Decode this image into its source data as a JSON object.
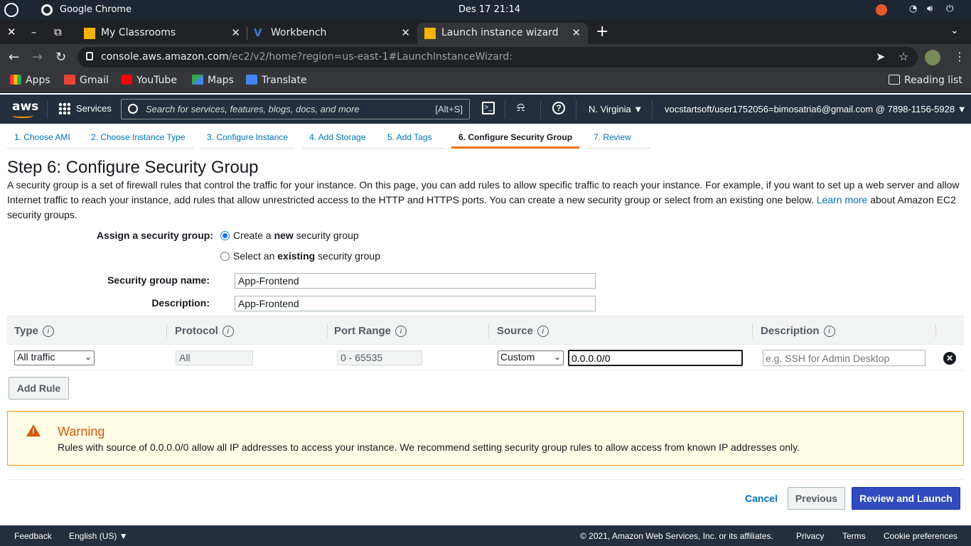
{
  "os": {
    "app_name": "Google Chrome",
    "clock": "Des 17  21:14",
    "tray": [
      "wifi-icon",
      "volume-icon",
      "power-icon"
    ]
  },
  "browser": {
    "tabs": [
      {
        "label": "My Classrooms",
        "icon": "classroom-icon",
        "color": "#f4b400"
      },
      {
        "label": "Workbench",
        "icon": "vocareum-icon",
        "color": "#3a7bd5"
      },
      {
        "label": "Launch instance wizard | E",
        "icon": "aws-cube-icon",
        "color": "#f4b400"
      }
    ],
    "url_host": "console.aws.amazon.com",
    "url_path": "/ec2/v2/home?region=us-east-1#LaunchInstanceWizard:",
    "bookmarks": [
      {
        "label": "Apps",
        "icon": "apps-grid-icon",
        "color": "#ea4335"
      },
      {
        "label": "Gmail",
        "icon": "gmail-icon",
        "color": "#ea4335"
      },
      {
        "label": "YouTube",
        "icon": "youtube-icon",
        "color": "#ff0000"
      },
      {
        "label": "Maps",
        "icon": "maps-icon",
        "color": "#34a853"
      },
      {
        "label": "Translate",
        "icon": "translate-icon",
        "color": "#4285f4"
      }
    ],
    "reading_list": "Reading list"
  },
  "aws": {
    "logo": "aws",
    "services": "Services",
    "search_placeholder": "Search for services, features, blogs, docs, and more",
    "search_shortcut": "[Alt+S]",
    "region": "N. Virginia",
    "account": "vocstartsoft/user1752056=bimosatria6@gmail.com @ 7898-1156-5928"
  },
  "wizard": {
    "steps": [
      "1. Choose AMI",
      "2. Choose Instance Type",
      "3. Configure Instance",
      "4. Add Storage",
      "5. Add Tags",
      "6. Configure Security Group",
      "7. Review"
    ],
    "active_step": 5,
    "title": "Step 6: Configure Security Group",
    "intro_text": "A security group is a set of firewall rules that control the traffic for your instance. On this page, you can add rules to allow specific traffic to reach your instance. For example, if you want to set up a web server and allow Internet traffic to reach your instance, add rules that allow unrestricted access to the HTTP and HTTPS ports. You can create a new security group or select from an existing one below.",
    "learn_more": "Learn more",
    "intro_tail": "about Amazon EC2 security groups.",
    "assign_label": "Assign a security group:",
    "option_new": {
      "before": "Create a ",
      "bold": "new",
      "after": " security group",
      "checked": true
    },
    "option_existing": {
      "before": "Select an ",
      "bold": "existing",
      "after": " security group",
      "checked": false
    },
    "name_label": "Security group name:",
    "name_value": "App-Frontend",
    "desc_label": "Description:",
    "desc_value": "App-Frontend"
  },
  "rules": {
    "columns": [
      "Type",
      "Protocol",
      "Port Range",
      "Source",
      "Description"
    ],
    "row": {
      "type": "All traffic",
      "protocol": "All",
      "port_range": "0 - 65535",
      "source_mode": "Custom",
      "source_cidr": "0.0.0.0/0",
      "description_placeholder": "e.g. SSH for Admin Desktop"
    },
    "add_rule": "Add Rule"
  },
  "warning": {
    "title": "Warning",
    "text": "Rules with source of 0.0.0.0/0 allow all IP addresses to access your instance. We recommend setting security group rules to allow access from known IP addresses only."
  },
  "actions": {
    "cancel": "Cancel",
    "previous": "Previous",
    "review_launch": "Review and Launch"
  },
  "footer": {
    "feedback": "Feedback",
    "language": "English (US)",
    "copyright": "© 2021, Amazon Web Services, Inc. or its affiliates.",
    "privacy": "Privacy",
    "terms": "Terms",
    "cookies": "Cookie preferences"
  }
}
